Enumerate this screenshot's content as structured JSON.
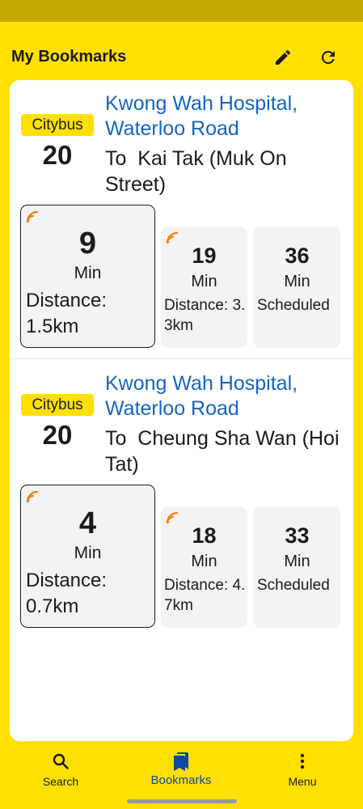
{
  "header": {
    "title": "My Bookmarks",
    "edit_icon": "pencil-icon",
    "refresh_icon": "refresh-icon"
  },
  "bookmarks": [
    {
      "operator": "Citybus",
      "route": "20",
      "stop": "Kwong Wah Hospital, Waterloo Road",
      "destination": "To  Kai Tak (Muk On Street)",
      "etas": [
        {
          "minutes": "9",
          "unit": "Min",
          "detail": "Distance: 1.5km",
          "realtime": true
        },
        {
          "minutes": "19",
          "unit": "Min",
          "detail": "Distance: 3.3km",
          "realtime": true
        },
        {
          "minutes": "36",
          "unit": "Min",
          "detail": "Scheduled",
          "realtime": false
        }
      ]
    },
    {
      "operator": "Citybus",
      "route": "20",
      "stop": "Kwong Wah Hospital, Waterloo Road",
      "destination": "To  Cheung Sha Wan (Hoi Tat)",
      "etas": [
        {
          "minutes": "4",
          "unit": "Min",
          "detail": "Distance: 0.7km",
          "realtime": true
        },
        {
          "minutes": "18",
          "unit": "Min",
          "detail": "Distance: 4.7km",
          "realtime": true
        },
        {
          "minutes": "33",
          "unit": "Min",
          "detail": "Scheduled",
          "realtime": false
        }
      ]
    }
  ],
  "nav": {
    "search": {
      "label": "Search",
      "icon": "search-icon"
    },
    "bookmarks": {
      "label": "Bookmarks",
      "icon": "bookmarks-icon",
      "active": true
    },
    "menu": {
      "label": "Menu",
      "icon": "more-vert-icon"
    }
  },
  "colors": {
    "accent": "#FFE000",
    "status_bar": "#C2A800",
    "link": "#1565C0",
    "active_nav": "#0D47A1",
    "realtime_icon": "#F57C00"
  }
}
